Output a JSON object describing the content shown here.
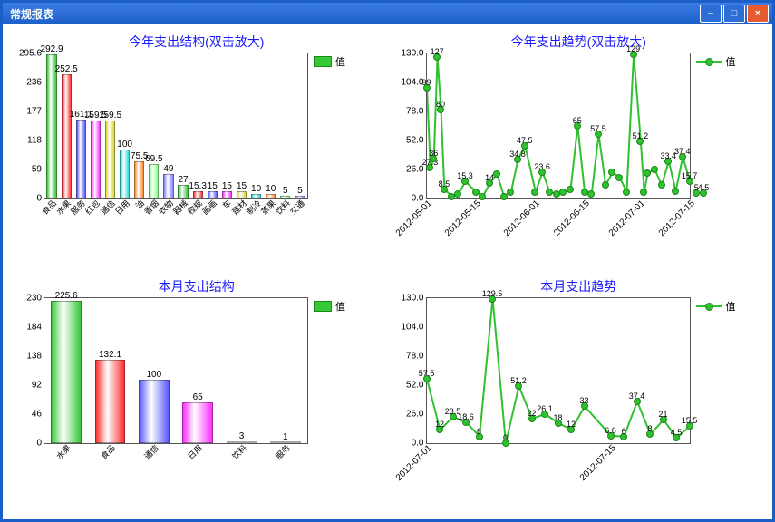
{
  "window": {
    "title": "常规报表"
  },
  "legend_label": "值",
  "chart_data": [
    {
      "id": "c1",
      "type": "bar",
      "title": "今年支出结构(双击放大)",
      "ylim": [
        0,
        295.6
      ],
      "yticks": [
        0,
        59.0,
        118.0,
        177.0,
        236.0,
        295.6
      ],
      "categories": [
        "食品",
        "水果",
        "服务",
        "红包",
        "通信",
        "日用",
        "油",
        "香烟",
        "衣物",
        "器械",
        "校规",
        "画画",
        "车",
        "建材",
        "制冷",
        "茶果",
        "饮料",
        "交通"
      ],
      "values": [
        292.9,
        252.5,
        161.1,
        159.5,
        159.5,
        100,
        75.5,
        69.5,
        49,
        27,
        15.3,
        15,
        15,
        15,
        10,
        10,
        5,
        5
      ],
      "colors": [
        "#37c837",
        "#ff3030",
        "#5a5aff",
        "#ff30ff",
        "#d8d830",
        "#30d8d8",
        "#ff8c30",
        "#80ff80",
        "#8080ff",
        "#30c837",
        "#ff3030",
        "#5a5aff",
        "#ff30ff",
        "#d8d830",
        "#30d8d8",
        "#ff8c30",
        "#80ff80",
        "#8080ff"
      ]
    },
    {
      "id": "c2",
      "type": "line",
      "title": "今年支出趋势(双击放大)",
      "ylim": [
        0,
        130.0
      ],
      "yticks": [
        0,
        26.0,
        52.0,
        78.0,
        104.0,
        130.0
      ],
      "xrange": [
        "2012-05-01",
        "2012-07-15"
      ],
      "xticks": [
        "2012-05-01",
        "2012-05-15",
        "2012-06-01",
        "2012-06-15",
        "2012-07-01",
        "2012-07-15"
      ],
      "x": [
        "2012-05-01",
        "2012-05-02",
        "2012-05-03",
        "2012-05-04",
        "2012-05-05",
        "2012-05-06",
        "2012-05-08",
        "2012-05-10",
        "2012-05-12",
        "2012-05-15",
        "2012-05-17",
        "2012-05-19",
        "2012-05-21",
        "2012-05-23",
        "2012-05-25",
        "2012-05-27",
        "2012-05-29",
        "2012-06-01",
        "2012-06-03",
        "2012-06-05",
        "2012-06-07",
        "2012-06-09",
        "2012-06-11",
        "2012-06-13",
        "2012-06-15",
        "2012-06-17",
        "2012-06-19",
        "2012-06-21",
        "2012-06-23",
        "2012-06-25",
        "2012-06-27",
        "2012-06-29",
        "2012-07-01",
        "2012-07-02",
        "2012-07-03",
        "2012-07-05",
        "2012-07-07",
        "2012-07-09",
        "2012-07-11",
        "2012-07-13",
        "2012-07-15",
        "2012-07-17",
        "2012-07-19"
      ],
      "values": [
        99,
        27.3,
        36,
        127,
        80,
        8.5,
        2,
        4,
        15.3,
        6,
        2,
        14,
        22,
        2,
        6,
        34.8,
        47.5,
        6,
        23.6,
        6,
        4,
        6,
        8,
        65,
        6,
        4,
        57.5,
        12,
        23.5,
        18.6,
        6,
        129,
        51.2,
        6,
        22.6,
        26.1,
        12,
        33.4,
        6.6,
        37.4,
        15.7,
        5,
        4.5
      ],
      "show_labels": [
        99,
        127,
        80,
        36,
        27.3,
        8.5,
        15.3,
        14,
        34.8,
        47.5,
        23.6,
        65,
        57.5,
        51.2,
        33.4,
        37.4,
        15.7,
        5,
        4.5,
        129
      ]
    },
    {
      "id": "c3",
      "type": "bar",
      "title": "本月支出结构",
      "ylim": [
        0,
        230.0
      ],
      "yticks": [
        0,
        46.0,
        92.0,
        138.0,
        184.0,
        230.0
      ],
      "categories": [
        "水果",
        "食品",
        "通信",
        "日用",
        "饮料",
        "服务"
      ],
      "values": [
        225.6,
        132.1,
        100,
        65,
        3,
        1
      ],
      "colors": [
        "#37c837",
        "#ff3030",
        "#5a5aff",
        "#ff30ff",
        "#d8d830",
        "#30d8d8"
      ]
    },
    {
      "id": "c4",
      "type": "line",
      "title": "本月支出趋势",
      "ylim": [
        0,
        130.0
      ],
      "yticks": [
        0,
        26.0,
        52.0,
        78.0,
        104.0,
        130.0
      ],
      "xrange": [
        "2012-07-01",
        "2012-07-21"
      ],
      "xticks": [
        "2012-07-01",
        "2012-07-15"
      ],
      "x": [
        "2012-07-01",
        "2012-07-02",
        "2012-07-03",
        "2012-07-04",
        "2012-07-05",
        "2012-07-06",
        "2012-07-07",
        "2012-07-08",
        "2012-07-09",
        "2012-07-10",
        "2012-07-11",
        "2012-07-12",
        "2012-07-13",
        "2012-07-15",
        "2012-07-16",
        "2012-07-17",
        "2012-07-18",
        "2012-07-19",
        "2012-07-20",
        "2012-07-21"
      ],
      "values": [
        57.5,
        12,
        23.5,
        18.6,
        6,
        129.5,
        0,
        51.2,
        22,
        26.1,
        18,
        12,
        33,
        6.6,
        6,
        37.4,
        8,
        21,
        4.5,
        15.5
      ],
      "show_labels": [
        57.5,
        12,
        23.5,
        18.6,
        6,
        129.5,
        0,
        51.2,
        22,
        26.1,
        18,
        12,
        33,
        6.6,
        6,
        37.4,
        8,
        21,
        4.5,
        15.5
      ]
    }
  ]
}
